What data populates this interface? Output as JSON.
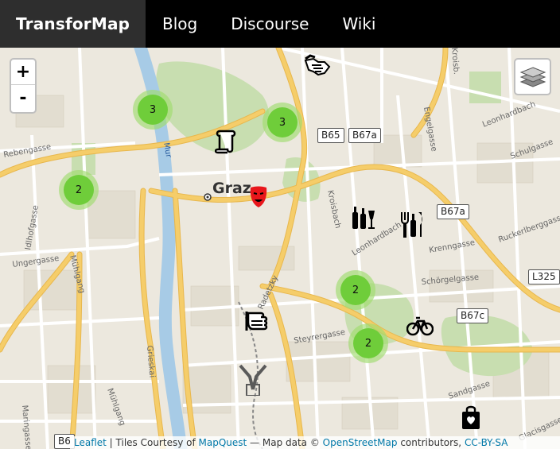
{
  "navbar": {
    "brand": "TransforMap",
    "links": [
      "Blog",
      "Discourse",
      "Wiki"
    ]
  },
  "map": {
    "city_label": "Graz",
    "river_labels": [
      "Mur"
    ],
    "street_labels": [
      "Rebengasse",
      "Idlhofgasse",
      "Ungergasse",
      "Mühlgang",
      "Grieskai",
      "Mühlgang",
      "Maringasse",
      "Leonhardbach",
      "Engelgasse",
      "Krenngasse",
      "Schörgelgasse",
      "Kroisbach",
      "Leonhardbach",
      "Steyrergasse",
      "Sandgasse",
      "Ruckerlberggasse",
      "Schulgasse",
      "Glacisgasse",
      "Kroisb.",
      "Radetzky"
    ],
    "road_shields": [
      "B65",
      "B67a",
      "B67a",
      "L325",
      "B67c",
      "B6"
    ],
    "clusters": [
      {
        "count": "3"
      },
      {
        "count": "3"
      },
      {
        "count": "2"
      },
      {
        "count": "2"
      },
      {
        "count": "2"
      }
    ],
    "markers": [
      "handshake-icon",
      "scroll-icon",
      "theater-mask-icon",
      "bottles-icon",
      "cutlery-bottle-icon",
      "hand-icon",
      "bicycle-icon",
      "shopping-bag-icon",
      "hands-icon"
    ]
  },
  "controls": {
    "zoom_in": "+",
    "zoom_out": "-"
  },
  "attribution": {
    "leaflet": "Leaflet",
    "sep1": " | Tiles Courtesy of ",
    "mapquest": "MapQuest",
    "sep2": " — Map data © ",
    "osm": "OpenStreetMap",
    "sep3": " contributors, ",
    "license": "CC-BY-SA"
  },
  "colors": {
    "navbar_bg": "#000000",
    "brand_bg": "#2e2e2e",
    "cluster_inner": "#6fcd3a",
    "cluster_outer": "#a0dc6e",
    "main_road": "#f5cd6a",
    "river": "#a7cbe6",
    "park": "#c8deb0",
    "link": "#0078a8"
  }
}
